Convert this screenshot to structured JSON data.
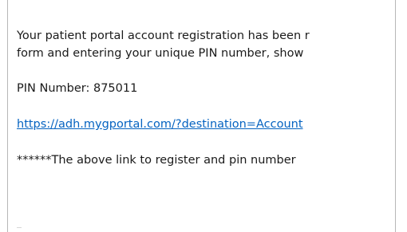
{
  "email": {
    "line1": "Your patient portal account registration has been r",
    "line2": "form and entering your unique PIN number, show",
    "pin_line": "PIN Number: 875011",
    "link_text": "https://adh.mygportal.com/?destination=Account",
    "notice": "******The above link to register and pin number"
  }
}
